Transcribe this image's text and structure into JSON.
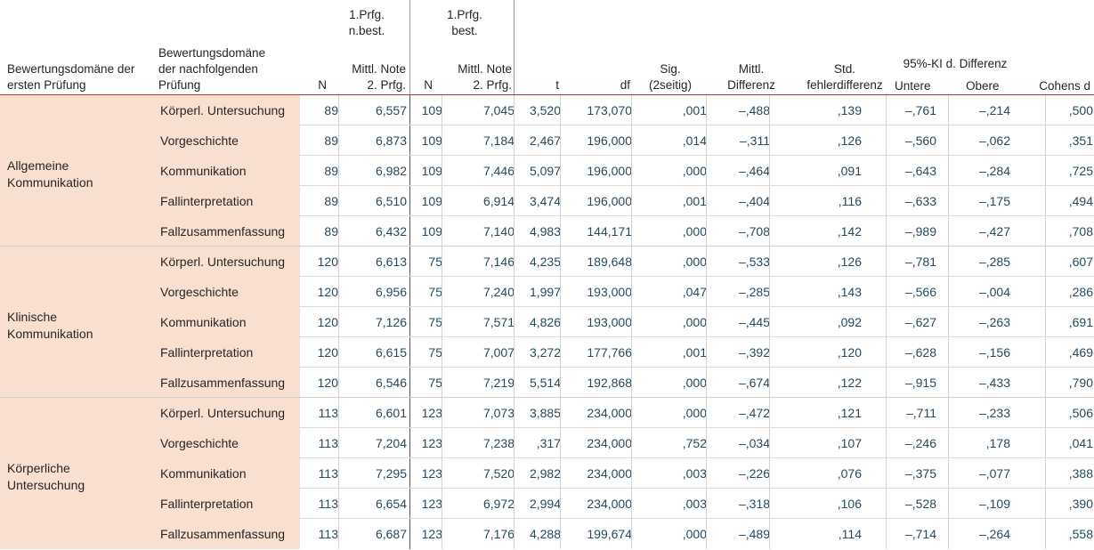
{
  "header": {
    "col_domain_first_l1": "Bewertungsdomäne der",
    "col_domain_first_l2": "ersten Prüfung",
    "col_domain_next_l1": "Bewertungsdomäne",
    "col_domain_next_l2": "der nachfolgenden",
    "col_domain_next_l3": "Prüfung",
    "group_nbest_l1": "1.Prfg.",
    "group_nbest_l2": "n.best.",
    "group_best_l1": "1.Prfg.",
    "group_best_l2": "best.",
    "n1": "N",
    "mean1_l1": "Mittl. Note",
    "mean1_l2": "2. Prfg.",
    "n2": "N",
    "mean2_l1": "Mittl. Note",
    "mean2_l2": "2. Prfg.",
    "t": "t",
    "df": "df",
    "sig_l1": "Sig.",
    "sig_l2": "(2seitig)",
    "md_l1": "Mittl.",
    "md_l2": "Differenz",
    "se_l1": "Std.",
    "se_l2": "fehlerdifferenz",
    "ci_title": "95%-KI d. Differenz",
    "ci_lower": "Untere",
    "ci_upper": "Obere",
    "cohen": "Cohens d"
  },
  "groups": [
    {
      "label_l1": "Allgemeine",
      "label_l2": "Kommunikation",
      "rows": [
        {
          "domain": "Körperl. Untersuchung",
          "n1": "89",
          "m1": "6,557",
          "n2": "109",
          "m2": "7,045",
          "t": "3,520",
          "df": "173,070",
          "sig": ",001",
          "md": "–,488",
          "se": ",139",
          "lo": "–,761",
          "up": "–,214",
          "d": ",500"
        },
        {
          "domain": "Vorgeschichte",
          "n1": "89",
          "m1": "6,873",
          "n2": "109",
          "m2": "7,184",
          "t": "2,467",
          "df": "196,000",
          "sig": ",014",
          "md": "–,311",
          "se": ",126",
          "lo": "–,560",
          "up": "–,062",
          "d": ",351"
        },
        {
          "domain": "Kommunikation",
          "n1": "89",
          "m1": "6,982",
          "n2": "109",
          "m2": "7,446",
          "t": "5,097",
          "df": "196,000",
          "sig": ",000",
          "md": "–,464",
          "se": ",091",
          "lo": "–,643",
          "up": "–,284",
          "d": ",725"
        },
        {
          "domain": "Fallinterpretation",
          "n1": "89",
          "m1": "6,510",
          "n2": "109",
          "m2": "6,914",
          "t": "3,474",
          "df": "196,000",
          "sig": ",001",
          "md": "–,404",
          "se": ",116",
          "lo": "–,633",
          "up": "–,175",
          "d": ",494"
        },
        {
          "domain": "Fallzusammenfassung",
          "n1": "89",
          "m1": "6,432",
          "n2": "109",
          "m2": "7,140",
          "t": "4,983",
          "df": "144,171",
          "sig": ",000",
          "md": "–,708",
          "se": ",142",
          "lo": "–,989",
          "up": "–,427",
          "d": ",708"
        }
      ]
    },
    {
      "label_l1": "Klinische",
      "label_l2": "Kommunikation",
      "rows": [
        {
          "domain": "Körperl. Untersuchung",
          "n1": "120",
          "m1": "6,613",
          "n2": "75",
          "m2": "7,146",
          "t": "4,235",
          "df": "189,648",
          "sig": ",000",
          "md": "–,533",
          "se": ",126",
          "lo": "–,781",
          "up": "–,285",
          "d": ",607"
        },
        {
          "domain": "Vorgeschichte",
          "n1": "120",
          "m1": "6,956",
          "n2": "75",
          "m2": "7,240",
          "t": "1,997",
          "df": "193,000",
          "sig": ",047",
          "md": "–,285",
          "se": ",143",
          "lo": "–,566",
          "up": "–,004",
          "d": ",286"
        },
        {
          "domain": "Kommunikation",
          "n1": "120",
          "m1": "7,126",
          "n2": "75",
          "m2": "7,571",
          "t": "4,826",
          "df": "193,000",
          "sig": ",000",
          "md": "–,445",
          "se": ",092",
          "lo": "–,627",
          "up": "–,263",
          "d": ",691"
        },
        {
          "domain": "Fallinterpretation",
          "n1": "120",
          "m1": "6,615",
          "n2": "75",
          "m2": "7,007",
          "t": "3,272",
          "df": "177,766",
          "sig": ",001",
          "md": "–,392",
          "se": ",120",
          "lo": "–,628",
          "up": "–,156",
          "d": ",469"
        },
        {
          "domain": "Fallzusammenfassung",
          "n1": "120",
          "m1": "6,546",
          "n2": "75",
          "m2": "7,219",
          "t": "5,514",
          "df": "192,868",
          "sig": ",000",
          "md": "–,674",
          "se": ",122",
          "lo": "–,915",
          "up": "–,433",
          "d": ",790"
        }
      ]
    },
    {
      "label_l1": "Körperliche",
      "label_l2": "Untersuchung",
      "rows": [
        {
          "domain": "Körperl. Untersuchung",
          "n1": "113",
          "m1": "6,601",
          "n2": "123",
          "m2": "7,073",
          "t": "3,885",
          "df": "234,000",
          "sig": ",000",
          "md": "–,472",
          "se": ",121",
          "lo": "–,711",
          "up": "–,233",
          "d": ",506"
        },
        {
          "domain": "Vorgeschichte",
          "n1": "113",
          "m1": "7,204",
          "n2": "123",
          "m2": "7,238",
          "t": ",317",
          "df": "234,000",
          "sig": ",752",
          "md": "–,034",
          "se": ",107",
          "lo": "–,246",
          "up": ",178",
          "d": ",041"
        },
        {
          "domain": "Kommunikation",
          "n1": "113",
          "m1": "7,295",
          "n2": "123",
          "m2": "7,520",
          "t": "2,982",
          "df": "234,000",
          "sig": ",003",
          "md": "–,226",
          "se": ",076",
          "lo": "–,375",
          "up": "–,077",
          "d": ",388"
        },
        {
          "domain": "Fallinterpretation",
          "n1": "113",
          "m1": "6,654",
          "n2": "123",
          "m2": "6,972",
          "t": "2,994",
          "df": "234,000",
          "sig": ",003",
          "md": "–,318",
          "se": ",106",
          "lo": "–,528",
          "up": "–,109",
          "d": ",390"
        },
        {
          "domain": "Fallzusammenfassung",
          "n1": "113",
          "m1": "6,687",
          "n2": "123",
          "m2": "7,176",
          "t": "4,288",
          "df": "199,674",
          "sig": ",000",
          "md": "–,489",
          "se": ",114",
          "lo": "–,714",
          "up": "–,264",
          "d": ",558"
        }
      ]
    }
  ]
}
